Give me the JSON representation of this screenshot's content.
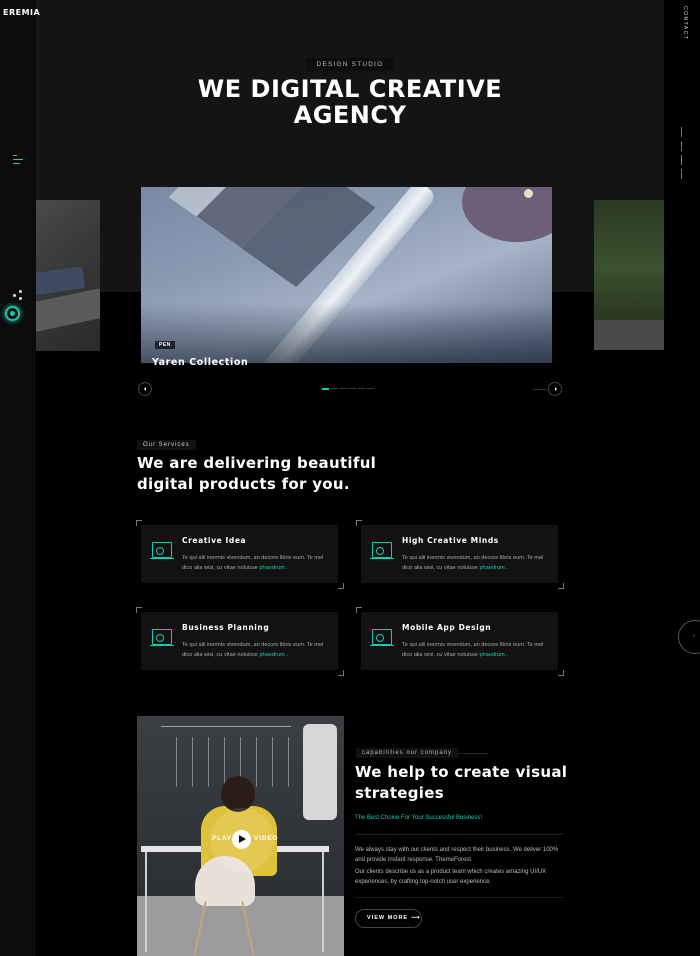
{
  "brand": {
    "logo": "EREMIA"
  },
  "right_nav": {
    "contact_label": "CONTACT"
  },
  "hero": {
    "tag": "DESIGN STUDIO",
    "title_line1": "WE DIGITAL CREATIVE",
    "title_line2": "AGENCY"
  },
  "slider": {
    "active_index": 0,
    "slide_count": 6,
    "badge": "PEN",
    "title": "Yaren Collection"
  },
  "services": {
    "label": "Our Services",
    "heading_line1": "We are delivering beautiful",
    "heading_line2": "digital products for you.",
    "cards": [
      {
        "title": "Creative Idea",
        "text": "Te qui alii inermis vivendum, an decore libris eum. Te mel dico alia wisi, cu vitae noluisse",
        "link": "phaedrum",
        "icon": "monitor-design-icon"
      },
      {
        "title": "High Creative Minds",
        "text": "Te qui alii inermis vivendum, an decore libris eum. Te mel dico alia wisi, cu vitae noluisse",
        "link": "phaedrum",
        "icon": "monitor-design-icon"
      },
      {
        "title": "Business Planning",
        "text": "Te qui alii inermis vivendum, an decore libris eum. Te mel dico alia wisi, cu vitae noluisse",
        "link": "phaedrum",
        "icon": "monitor-design-icon"
      },
      {
        "title": "Mobile App Design",
        "text": "Te qui alii inermis vivendum, an decore libris eum. Te mel dico alia wisi, cu vitae noluisse",
        "link": "phaedrum",
        "icon": "monitor-design-icon"
      }
    ]
  },
  "video": {
    "play_label": "PLAY",
    "video_label": "VIDEO"
  },
  "capabilities": {
    "label": "capabilities our company",
    "heading_line1": "We help to create visual",
    "heading_line2": "strategies",
    "subheading": "The Best Choice For Your Successful Business!",
    "paragraph1": "We always stay with our clients and respect their business. We deliver 100% and provide instant response. ThemeForest.",
    "paragraph2": "Our clients describe us as a product team which creates amazing UI/UX experiences, by crafting top-notch user experience.",
    "button_label": "VIEW MORE",
    "button_arrow": "⟶"
  },
  "colors": {
    "accent": "#1bc9b0",
    "background": "#000000",
    "card": "#121212"
  }
}
